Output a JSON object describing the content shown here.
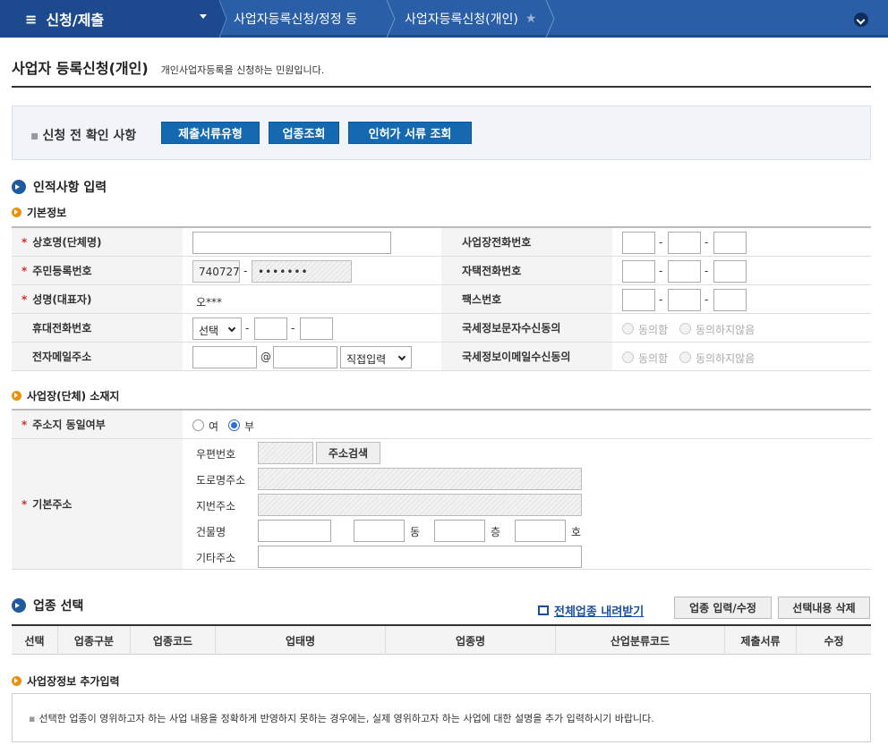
{
  "nav": {
    "menu_icon": "≡",
    "menu_title": "신청/제출",
    "crumb1": "사업자등록신청/정정 등",
    "crumb2": "사업자등록신청(개인)",
    "star": "★"
  },
  "page": {
    "title": "사업자 등록신청(개인)",
    "description": "개인사업자등록을 신청하는 민원입니다."
  },
  "pre_check": {
    "label": "신청 전 확인 사항",
    "buttons": [
      "제출서류유형",
      "업종조회",
      "인허가 서류 조회"
    ]
  },
  "sections": {
    "personal": "인적사항 입력",
    "basic": "기본정보",
    "location": "사업장(단체) 소재지",
    "industry": "업종 선택",
    "additional": "사업장정보 추가입력"
  },
  "basic_info": {
    "company_name": "상호명(단체명)",
    "biz_phone": "사업장전화번호",
    "resident_no": "주민등록번호",
    "resident_front": "740727",
    "resident_back": "•••••••",
    "home_phone": "자택전화번호",
    "name": "성명(대표자)",
    "name_value": "오***",
    "fax": "팩스번호",
    "mobile": "휴대전화번호",
    "mobile_select": "선택",
    "sms_consent": "국세정보문자수신동의",
    "email": "전자메일주소",
    "email_at": "@",
    "email_select": "직접입력",
    "email_consent": "국세정보이메일수신동의",
    "agree": "동의함",
    "disagree": "동의하지않음",
    "dash": "-"
  },
  "location": {
    "same_address": "주소지 동일여부",
    "yes": "여",
    "no": "부",
    "base_address": "기본주소",
    "zip": "우편번호",
    "search_btn": "주소검색",
    "road": "도로명주소",
    "lot": "지번주소",
    "building": "건물명",
    "dong": "동",
    "floor": "층",
    "ho": "호",
    "other": "기타주소"
  },
  "industry": {
    "download": "전체업종 내려받기",
    "edit_btn": "업종 입력/수정",
    "delete_btn": "선택내용 삭제",
    "columns": [
      "선택",
      "업종구분",
      "업종코드",
      "업태명",
      "업종명",
      "산업분류코드",
      "제출서류",
      "수정"
    ]
  },
  "note": "선택한 업종이 영위하고자 하는 사업 내용을 정확하게 반영하지 못하는 경우에는, 실제 영위하고자 하는 사업에 대한 설명을 추가 입력하시기 바랍니다."
}
